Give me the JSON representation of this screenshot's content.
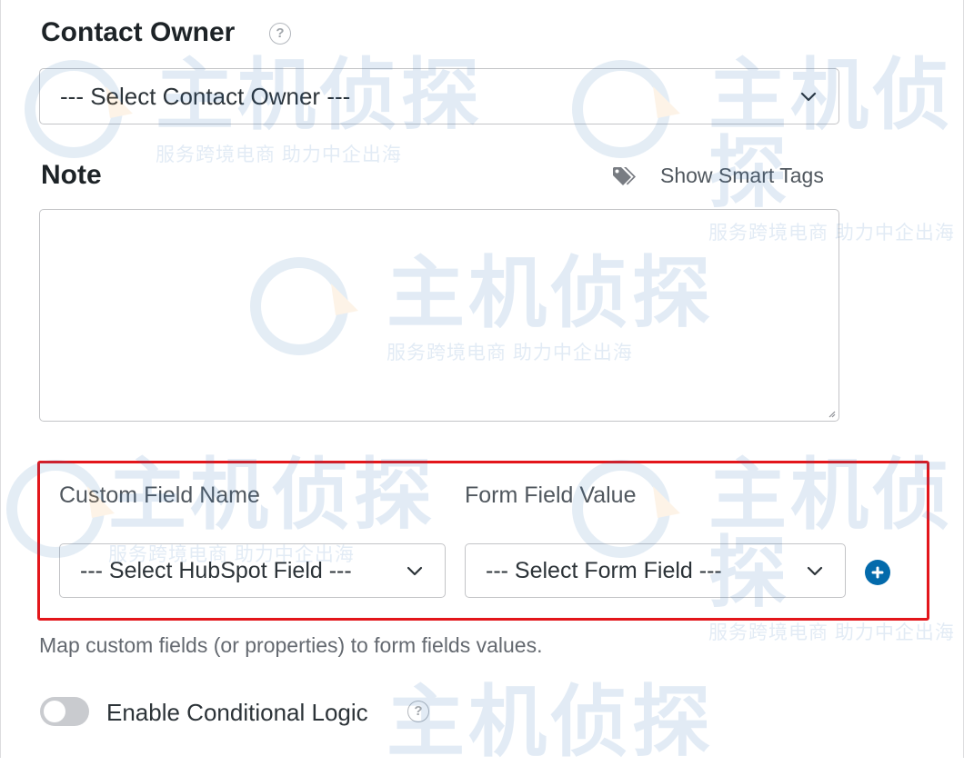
{
  "contact_owner": {
    "label": "Contact Owner",
    "help": "?",
    "select_value": "--- Select Contact Owner ---"
  },
  "note": {
    "label": "Note",
    "smart_tags_label": "Show Smart Tags",
    "value": ""
  },
  "custom_fields": {
    "col_name_header": "Custom Field Name",
    "col_value_header": "Form Field Value",
    "hubspot_select": "--- Select HubSpot Field ---",
    "form_select": "--- Select Form Field ---",
    "help_text": "Map custom fields (or properties) to form fields values."
  },
  "conditional_logic": {
    "label": "Enable Conditional Logic",
    "help": "?",
    "enabled": false
  },
  "watermark": {
    "title": "主机侦探",
    "subtitle": "服务跨境电商 助力中企出海"
  },
  "colors": {
    "highlight": "#e3161b",
    "accent": "#036aab"
  }
}
